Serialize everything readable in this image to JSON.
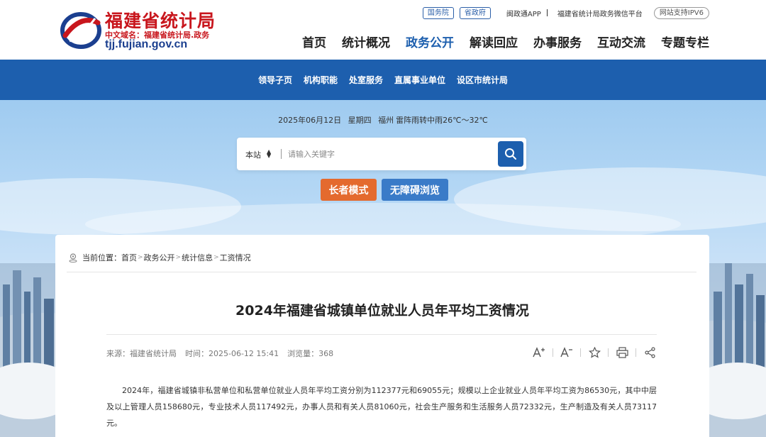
{
  "header": {
    "logo_title": "福建省统计局",
    "logo_domain_cn": "中文域名：福建省统计局.政务",
    "logo_domain_en": "tjj.fujian.gov.cn",
    "top_links": {
      "guowuyuan": "国务院",
      "shengzhengfu": "省政府",
      "app": "闽政通APP",
      "wechat": "福建省统计局政务微信平台",
      "ipv6": "网站支持IPV6"
    },
    "nav": [
      "首页",
      "统计概况",
      "政务公开",
      "解读回应",
      "办事服务",
      "互动交流",
      "专题专栏"
    ],
    "nav_active": "政务公开"
  },
  "subnav": [
    "领导子页",
    "机构职能",
    "处室服务",
    "直属事业单位",
    "设区市统计局"
  ],
  "hero": {
    "date": "2025年06月12日",
    "weekday": "星期四",
    "city": "福州",
    "weather": "雷阵雨转中雨26℃～32℃",
    "search_scope": "本站",
    "search_placeholder": "请输入关键字",
    "elder_mode": "长者模式",
    "accessible_mode": "无障碍浏览"
  },
  "article": {
    "breadcrumb_label": "当前位置：",
    "breadcrumb": [
      "首页",
      "政务公开",
      "统计信息",
      "工资情况"
    ],
    "title": "2024年福建省城镇单位就业人员年平均工资情况",
    "source": "来源：福建省统计局",
    "time": "时间：2025-06-12 15:41",
    "views": "浏览量：368",
    "body": "2024年，福建省城镇非私营单位和私营单位就业人员年平均工资分别为112377元和69055元；规模以上企业就业人员年平均工资为86530元，其中中层及以上管理人员158680元，专业技术人员117492元，办事人员和有关人员81060元，社会生产服务和生活服务人员72332元，生产制造及有关人员73117元。"
  },
  "colors": {
    "brand_blue": "#1d5fae",
    "logo_red": "#c8161d",
    "elder_orange": "#e46a2e",
    "access_blue": "#3a7bc8"
  },
  "icons": [
    "emblem-logo",
    "chevron-updown-icon",
    "search-icon",
    "location-icon",
    "font-increase-icon",
    "font-decrease-icon",
    "star-icon",
    "print-icon",
    "share-icon"
  ]
}
